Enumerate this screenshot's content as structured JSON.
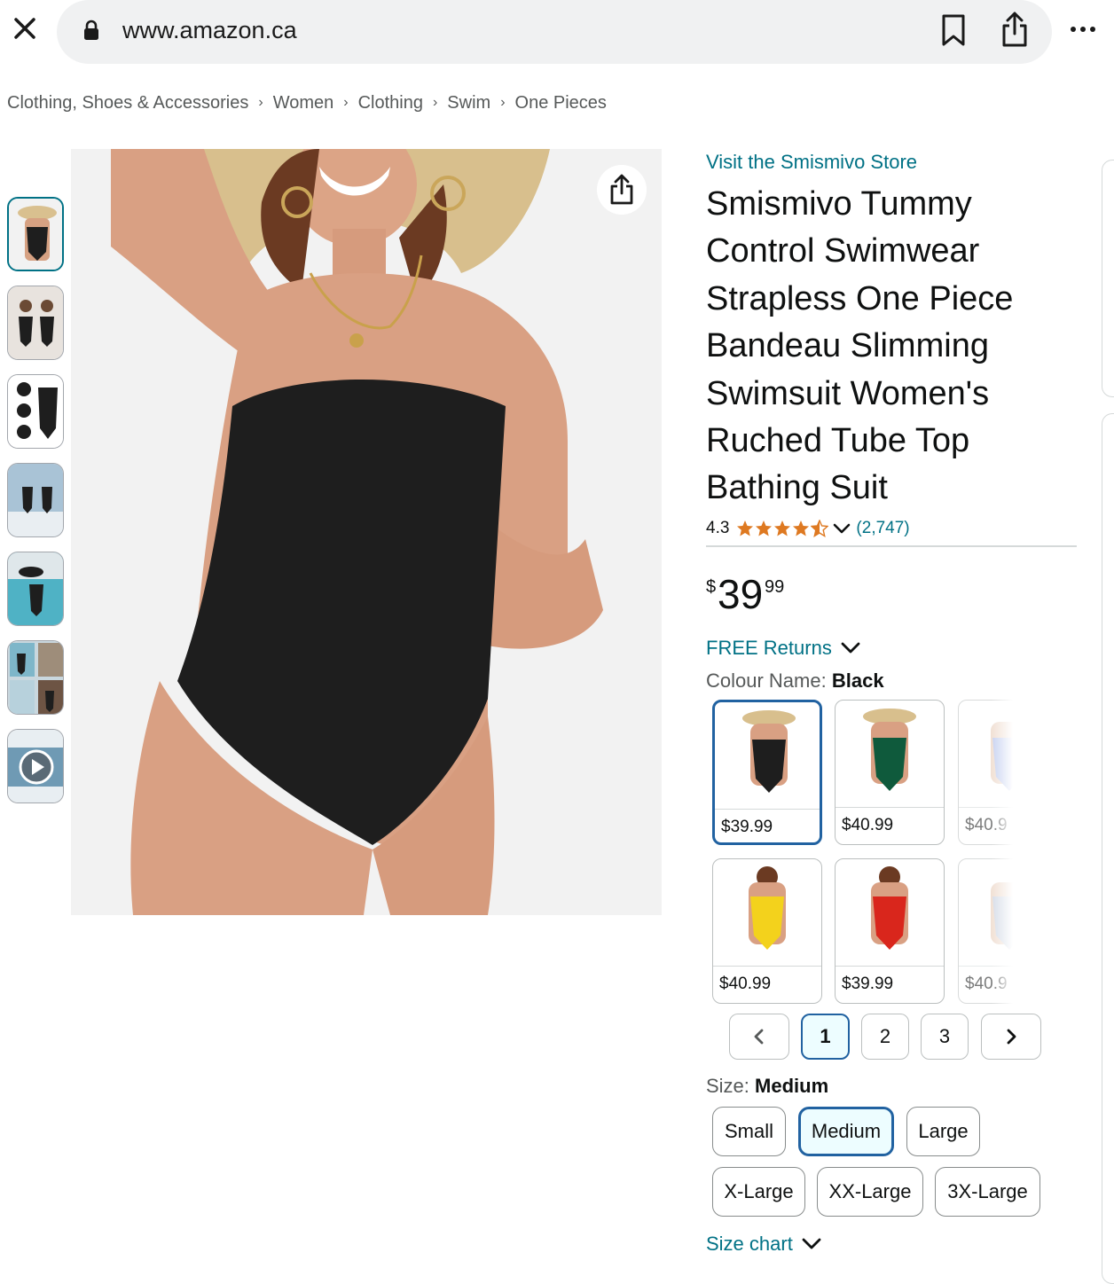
{
  "browser": {
    "url": "www.amazon.ca",
    "icons": [
      "close-icon",
      "lock-icon",
      "bookmark-icon",
      "share-icon",
      "more-icon"
    ]
  },
  "breadcrumb": [
    "Clothing, Shoes & Accessories",
    "Women",
    "Clothing",
    "Swim",
    "One Pieces"
  ],
  "gallery": {
    "thumbnail_count": 7,
    "selected_index": 0,
    "last_is_video": true
  },
  "product": {
    "store_link": "Visit the Smismivo Store",
    "title": "Smismivo Tummy Control Swimwear Strapless One Piece Bandeau Slimming Swimsuit Women's Ruched Tube Top Bathing Suit",
    "rating": "4.3",
    "stars": 4.5,
    "review_count": "(2,747)",
    "price": {
      "symbol": "$",
      "whole": "39",
      "fraction": "99"
    },
    "free_returns": "FREE Returns",
    "colour_label": "Colour Name: ",
    "colour_value": "Black",
    "colours": [
      {
        "price": "$39.99",
        "swatch": "#1e1e1e",
        "selected": true
      },
      {
        "price": "$40.99",
        "swatch": "#0f5a3c",
        "selected": false
      },
      {
        "price": "$40.9",
        "swatch": "#9fb2e6",
        "selected": false
      },
      {
        "price": "$40.99",
        "swatch": "#f3d21c",
        "selected": false
      },
      {
        "price": "$39.99",
        "swatch": "#d9261c",
        "selected": false
      },
      {
        "price": "$40.9",
        "swatch": "#b9c4d8",
        "selected": false
      }
    ],
    "pager": {
      "pages": [
        "1",
        "2",
        "3"
      ],
      "current": "1"
    },
    "size_label": "Size: ",
    "size_value": "Medium",
    "sizes": [
      "Small",
      "Medium",
      "Large",
      "X-Large",
      "XX-Large",
      "3X-Large"
    ],
    "size_selected": "Medium",
    "size_chart": "Size chart"
  },
  "colors": {
    "link": "#007185",
    "selected_border": "#2162a1",
    "star": "#de7921"
  }
}
